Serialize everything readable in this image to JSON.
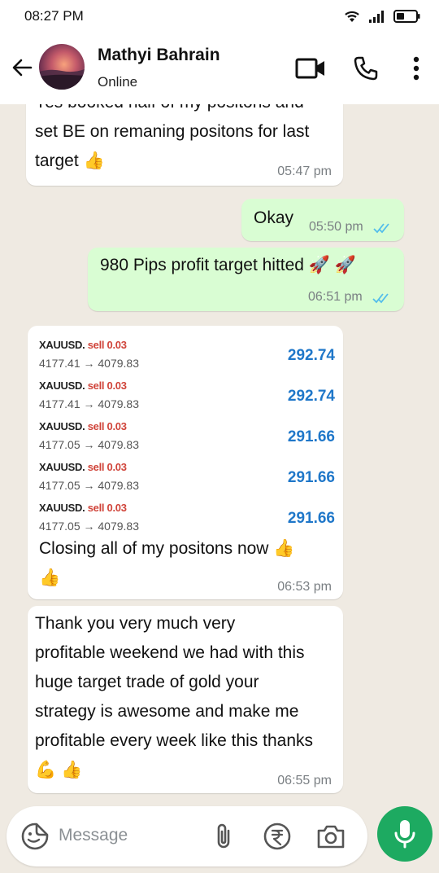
{
  "status_bar": {
    "time": "08:27 PM"
  },
  "header": {
    "contact_name": "Mathyi Bahrain",
    "contact_status": "Online"
  },
  "messages": [
    {
      "direction": "incoming",
      "lines": [
        "Yes booked half of my positons and",
        "set BE on remaning positons for last",
        "target 👍"
      ],
      "time": "05:47 pm"
    },
    {
      "direction": "outgoing",
      "text": "Okay",
      "time": "05:50 pm"
    },
    {
      "direction": "outgoing",
      "text": "980 Pips profit target hitted 🚀 🚀",
      "time": "06:51 pm"
    },
    {
      "direction": "incoming",
      "trades": [
        {
          "symbol": "XAUUSD.",
          "side": "sell 0.03",
          "prices": "4177.41 → 4079.83",
          "profit": "292.74"
        },
        {
          "symbol": "XAUUSD.",
          "side": "sell 0.03",
          "prices": "4177.41 → 4079.83",
          "profit": "292.74"
        },
        {
          "symbol": "XAUUSD.",
          "side": "sell 0.03",
          "prices": "4177.05 → 4079.83",
          "profit": "291.66"
        },
        {
          "symbol": "XAUUSD.",
          "side": "sell 0.03",
          "prices": "4177.05 → 4079.83",
          "profit": "291.66"
        },
        {
          "symbol": "XAUUSD.",
          "side": "sell 0.03",
          "prices": "4177.05 → 4079.83",
          "profit": "291.66"
        }
      ],
      "lines": [
        "Closing all of my positons now 👍",
        "👍"
      ],
      "time": "06:53 pm"
    },
    {
      "direction": "incoming",
      "lines": [
        " Thank you very much very",
        "profitable weekend we had with this",
        "huge target trade of gold your",
        "strategy is awesome and make me",
        "profitable every week like this thanks",
        "💪 👍"
      ],
      "time": "06:55 pm"
    }
  ],
  "input": {
    "placeholder": "Message"
  },
  "colors": {
    "chat_background": "#efeae2",
    "outgoing_bubble": "#d9fdd3",
    "incoming_bubble": "#ffffff",
    "read_ticks": "#53bdeb",
    "mic_button": "#1daa61",
    "profit_blue": "#1f77c9",
    "sell_red": "#d0443a"
  },
  "icons": [
    "wifi-icon",
    "signal-icon",
    "battery-icon",
    "back-arrow-icon",
    "video-call-icon",
    "phone-call-icon",
    "more-options-icon",
    "sticker-icon",
    "attach-icon",
    "rupee-payment-icon",
    "camera-icon",
    "mic-icon",
    "read-ticks-icon"
  ]
}
